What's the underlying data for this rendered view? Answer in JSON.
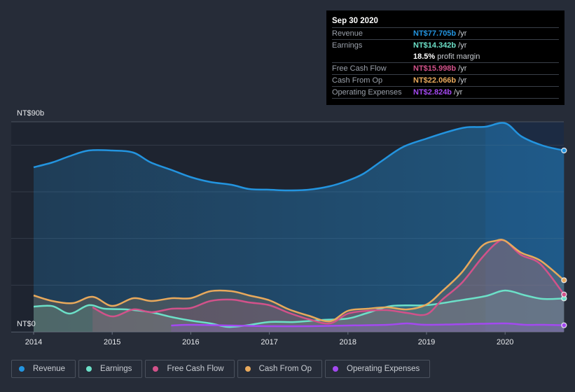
{
  "tooltip": {
    "date": "Sep 30 2020",
    "rows": [
      {
        "label": "Revenue",
        "value": "NT$77.705b",
        "unit": "/yr",
        "color": "#2394df"
      },
      {
        "label": "Earnings",
        "value": "NT$14.342b",
        "unit": "/yr",
        "color": "#6ce0c8"
      },
      {
        "label": "",
        "value": "18.5%",
        "unit": "profit margin",
        "color": "#ffffff"
      },
      {
        "label": "Free Cash Flow",
        "value": "NT$15.998b",
        "unit": "/yr",
        "color": "#d2528a"
      },
      {
        "label": "Cash From Op",
        "value": "NT$22.066b",
        "unit": "/yr",
        "color": "#e8a95c"
      },
      {
        "label": "Operating Expenses",
        "value": "NT$2.824b",
        "unit": "/yr",
        "color": "#a349f0"
      }
    ]
  },
  "legend": [
    {
      "label": "Revenue",
      "color": "#2394df"
    },
    {
      "label": "Earnings",
      "color": "#6ce0c8"
    },
    {
      "label": "Free Cash Flow",
      "color": "#d2528a"
    },
    {
      "label": "Cash From Op",
      "color": "#e8a95c"
    },
    {
      "label": "Operating Expenses",
      "color": "#a349f0"
    }
  ],
  "chart_data": {
    "type": "area",
    "title": "",
    "xlabel": "",
    "ylabel": "",
    "ylim": [
      0,
      90
    ],
    "xlim": [
      2014.0,
      2020.75
    ],
    "y_tick_labels": [
      {
        "value": 90,
        "label": "NT$90b"
      },
      {
        "value": 0,
        "label": "NT$0"
      }
    ],
    "gridlines_at": [
      0,
      20,
      40,
      60,
      80,
      90
    ],
    "x_ticks": [
      2014,
      2015,
      2016,
      2017,
      2018,
      2019,
      2020
    ],
    "x_tick_labels": [
      "2014",
      "2015",
      "2016",
      "2017",
      "2018",
      "2019",
      "2020"
    ],
    "highlight_from": 2019.75,
    "unit": "NT$ billions",
    "series": [
      {
        "name": "Revenue",
        "color": "#2394df",
        "x": [
          2014.0,
          2014.24,
          2014.46,
          2014.7,
          2015.0,
          2015.27,
          2015.49,
          2015.76,
          2016.0,
          2016.25,
          2016.52,
          2016.74,
          2017.0,
          2017.23,
          2017.5,
          2017.77,
          2018.0,
          2018.2,
          2018.43,
          2018.7,
          2019.0,
          2019.28,
          2019.5,
          2019.75,
          2020.0,
          2020.21,
          2020.48,
          2020.75
        ],
        "values": [
          70.5,
          72.6,
          75.3,
          77.7,
          77.7,
          76.8,
          72.6,
          69.3,
          66.3,
          64.2,
          63.0,
          61.2,
          60.9,
          60.6,
          60.9,
          62.4,
          64.8,
          67.8,
          73.2,
          79.2,
          82.8,
          85.8,
          87.6,
          87.9,
          89.4,
          83.7,
          79.8,
          77.7
        ]
      },
      {
        "name": "Earnings",
        "color": "#6ce0c8",
        "x": [
          2014.0,
          2014.24,
          2014.46,
          2014.7,
          2014.9,
          2015.18,
          2015.49,
          2015.76,
          2016.0,
          2016.25,
          2016.47,
          2016.7,
          2017.0,
          2017.32,
          2017.68,
          2018.0,
          2018.25,
          2018.56,
          2019.0,
          2019.37,
          2019.75,
          2020.0,
          2020.26,
          2020.48,
          2020.75
        ],
        "values": [
          10.8,
          11.0,
          7.8,
          11.4,
          9.9,
          9.6,
          8.4,
          6.3,
          4.8,
          3.6,
          2.1,
          2.7,
          4.2,
          4.2,
          5.1,
          5.7,
          8.1,
          11.1,
          11.4,
          13.2,
          15.3,
          17.7,
          15.6,
          14.1,
          14.3
        ]
      },
      {
        "name": "Free Cash Flow",
        "color": "#d2528a",
        "x": [
          2014.75,
          2015.0,
          2015.27,
          2015.5,
          2015.76,
          2016.0,
          2016.25,
          2016.52,
          2016.74,
          2017.0,
          2017.25,
          2017.5,
          2017.77,
          2018.0,
          2018.25,
          2018.5,
          2018.75,
          2019.0,
          2019.2,
          2019.45,
          2019.7,
          2019.88,
          2020.0,
          2020.2,
          2020.45,
          2020.75
        ],
        "values": [
          10.5,
          6.6,
          9.6,
          8.4,
          9.9,
          10.2,
          13.2,
          13.8,
          12.6,
          11.4,
          8.1,
          5.4,
          3.6,
          7.8,
          9.0,
          9.3,
          8.1,
          7.5,
          13.8,
          21.0,
          31.5,
          37.8,
          39.0,
          33.0,
          29.0,
          16.0
        ]
      },
      {
        "name": "Cash From Op",
        "color": "#e8a95c",
        "x": [
          2014.0,
          2014.24,
          2014.5,
          2014.75,
          2015.0,
          2015.27,
          2015.5,
          2015.76,
          2016.0,
          2016.25,
          2016.52,
          2016.74,
          2017.0,
          2017.25,
          2017.5,
          2017.77,
          2018.0,
          2018.25,
          2018.5,
          2018.75,
          2019.0,
          2019.2,
          2019.45,
          2019.7,
          2019.88,
          2020.0,
          2020.2,
          2020.45,
          2020.75
        ],
        "values": [
          15.6,
          13.2,
          12.3,
          15.0,
          11.1,
          14.4,
          13.2,
          14.4,
          14.4,
          17.4,
          17.4,
          15.6,
          13.5,
          9.6,
          6.9,
          4.5,
          9.0,
          9.9,
          10.5,
          9.6,
          11.7,
          17.4,
          25.5,
          36.6,
          39.0,
          39.0,
          34.0,
          30.5,
          22.1
        ]
      },
      {
        "name": "Operating Expenses",
        "color": "#a349f0",
        "x": [
          2015.75,
          2016.0,
          2016.5,
          2017.0,
          2017.5,
          2018.0,
          2018.5,
          2018.75,
          2019.0,
          2019.5,
          2020.0,
          2020.25,
          2020.5,
          2020.75
        ],
        "values": [
          2.7,
          3.0,
          2.7,
          2.4,
          2.4,
          2.7,
          3.0,
          3.6,
          3.0,
          3.3,
          3.6,
          3.0,
          3.0,
          2.8
        ]
      }
    ]
  }
}
